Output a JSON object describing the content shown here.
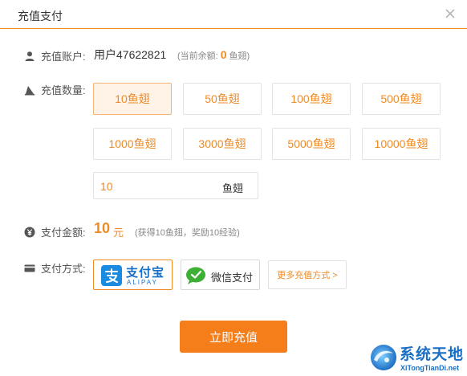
{
  "dialog": {
    "title": "充值支付",
    "close_icon": "close-icon"
  },
  "account": {
    "label": "充值账户:",
    "value": "用户47622821",
    "balance_prefix": "(当前余额:",
    "balance_value": "0",
    "balance_suffix": "鱼翅)"
  },
  "quantity": {
    "label": "充值数量:",
    "options": [
      "10鱼翅",
      "50鱼翅",
      "100鱼翅",
      "500鱼翅",
      "1000鱼翅",
      "3000鱼翅",
      "5000鱼翅",
      "10000鱼翅"
    ],
    "selected": "10鱼翅",
    "custom_value": "10",
    "custom_unit": "鱼翅"
  },
  "payment_amount": {
    "label": "支付金额:",
    "value": "10",
    "unit": "元",
    "note": "(获得10鱼翅，奖励10经验)"
  },
  "payment_method": {
    "label": "支付方式:",
    "alipay_text": "支付宝",
    "alipay_sub": "ALIPAY",
    "wechat_text": "微信支付",
    "more_label": "更多充值方式 >"
  },
  "submit_label": "立即充值",
  "watermark": {
    "title": "系统天地",
    "url": "XiTongTianDi.net"
  },
  "colors": {
    "accent": "#f08a24",
    "button": "#f57e1a",
    "alipay_blue": "#1a8be0",
    "wechat_green": "#3cb034"
  }
}
